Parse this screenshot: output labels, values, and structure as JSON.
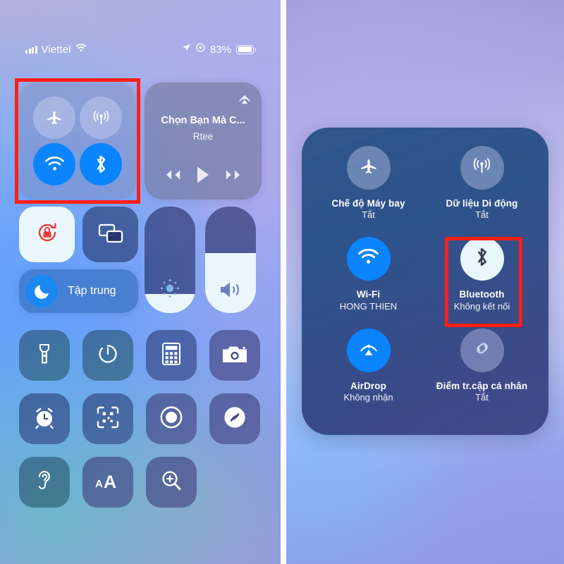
{
  "status_bar": {
    "signal_icon": "cellular-bars-icon",
    "carrier": "Viettel",
    "wifi_icon": "wifi-icon",
    "location_icon": "location-arrow-icon",
    "focus_icon": "focus-target-icon",
    "battery_percent": "83%",
    "battery_level": 83,
    "battery_icon": "battery-icon"
  },
  "left_panel": {
    "name": "Control Center",
    "connectivity": {
      "toggles": [
        {
          "name": "Chế độ Máy bay",
          "icon": "airplane-icon",
          "state": "off"
        },
        {
          "name": "Dữ liệu Di động",
          "icon": "cellular-antenna-icon",
          "state": "off"
        },
        {
          "name": "Wi-Fi",
          "icon": "wifi-icon",
          "state": "on"
        },
        {
          "name": "Bluetooth",
          "icon": "bluetooth-icon",
          "state": "on"
        }
      ]
    },
    "now_playing": {
      "airplay_icon": "airplay-audio-icon",
      "track_title": "Chọn Bạn Mà C...",
      "artist": "Rtee",
      "rewind_icon": "rewind-icon",
      "play_icon": "play-icon",
      "forward_icon": "fast-forward-icon"
    },
    "tiles": [
      {
        "name": "Khóa hướng màn hình",
        "icon": "rotation-lock-icon",
        "state": "on"
      },
      {
        "name": "Phản chiếu màn hình",
        "icon": "screen-mirroring-icon",
        "state": "off"
      }
    ],
    "focus": {
      "label": "Tập trung",
      "icon": "moon-icon",
      "state": "on"
    },
    "sliders": [
      {
        "name": "Độ sáng",
        "icon": "brightness-icon",
        "value": 18
      },
      {
        "name": "Âm lượng",
        "icon": "volume-icon",
        "value": 56
      }
    ],
    "apps": [
      {
        "name": "Đèn pin",
        "icon": "flashlight-icon"
      },
      {
        "name": "Hẹn giờ",
        "icon": "timer-icon"
      },
      {
        "name": "Máy tính",
        "icon": "calculator-icon"
      },
      {
        "name": "Camera",
        "icon": "camera-icon"
      },
      {
        "name": "Báo thức",
        "icon": "alarm-clock-icon"
      },
      {
        "name": "Quét mã QR",
        "icon": "qr-code-scanner-icon"
      },
      {
        "name": "Ghi màn hình",
        "icon": "screen-record-icon"
      },
      {
        "name": "Shazam",
        "icon": "shazam-icon"
      },
      {
        "name": "Nghe trực tiếp",
        "icon": "hearing-ear-icon"
      },
      {
        "name": "Cỡ chữ",
        "icon": "text-size-icon"
      },
      {
        "name": "Kính lúp",
        "icon": "magnifier-plus-icon"
      }
    ]
  },
  "right_panel": {
    "name": "Bluetooth expanded controls",
    "items": [
      {
        "name": "Chế độ Máy bay",
        "state": "Tắt",
        "icon": "airplane-icon",
        "style": "off"
      },
      {
        "name": "Dữ liệu Di động",
        "state": "Tắt",
        "icon": "cellular-antenna-icon",
        "style": "off"
      },
      {
        "name": "Wi-Fi",
        "state": "HONG THIEN",
        "icon": "wifi-icon",
        "style": "on"
      },
      {
        "name": "Bluetooth",
        "state": "Không kết nối",
        "icon": "bluetooth-icon",
        "style": "active"
      },
      {
        "name": "AirDrop",
        "state": "Không nhận",
        "icon": "airdrop-icon",
        "style": "on"
      },
      {
        "name": "Điểm tr.cập cá nhân",
        "state": "Tắt",
        "icon": "hotspot-link-icon",
        "style": "off"
      }
    ]
  },
  "annotations": {
    "color": "#ff1f16",
    "boxes": [
      {
        "name": "connectivity-group-highlight",
        "target": "left connectivity module"
      },
      {
        "name": "bluetooth-tile-highlight",
        "target": "right panel Bluetooth tile"
      }
    ]
  }
}
